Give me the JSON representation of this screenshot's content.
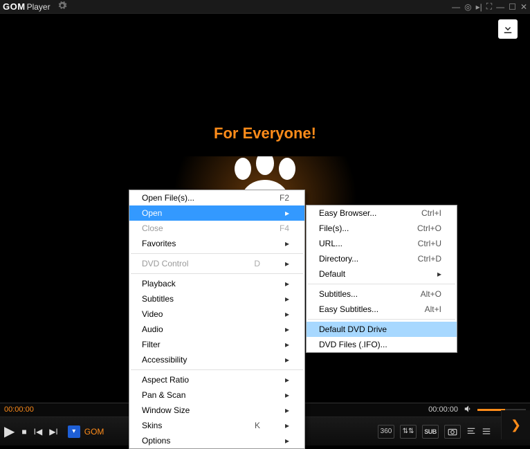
{
  "app": {
    "logo_bold": "GOM",
    "logo_rest": "Player"
  },
  "hero": {
    "title": "For Everyone!"
  },
  "menu_main": [
    {
      "type": "item",
      "label": "Open File(s)...",
      "shortcut": "F2"
    },
    {
      "type": "item",
      "label": "Open",
      "arrow": true,
      "state": "highlight"
    },
    {
      "type": "item",
      "label": "Close",
      "shortcut": "F4",
      "state": "disabled"
    },
    {
      "type": "item",
      "label": "Favorites",
      "arrow": true
    },
    {
      "type": "sep"
    },
    {
      "type": "item",
      "label": "DVD Control",
      "shortcut": "D",
      "arrow": true,
      "state": "disabled"
    },
    {
      "type": "sep"
    },
    {
      "type": "item",
      "label": "Playback",
      "arrow": true
    },
    {
      "type": "item",
      "label": "Subtitles",
      "arrow": true
    },
    {
      "type": "item",
      "label": "Video",
      "arrow": true
    },
    {
      "type": "item",
      "label": "Audio",
      "arrow": true
    },
    {
      "type": "item",
      "label": "Filter",
      "arrow": true
    },
    {
      "type": "item",
      "label": "Accessibility",
      "arrow": true
    },
    {
      "type": "sep"
    },
    {
      "type": "item",
      "label": "Aspect Ratio",
      "arrow": true
    },
    {
      "type": "item",
      "label": "Pan & Scan",
      "arrow": true
    },
    {
      "type": "item",
      "label": "Window Size",
      "arrow": true
    },
    {
      "type": "item",
      "label": "Skins",
      "shortcut": "K",
      "arrow": true
    },
    {
      "type": "item",
      "label": "Options",
      "arrow": true
    }
  ],
  "menu_sub": [
    {
      "type": "item",
      "label": "Easy Browser...",
      "shortcut": "Ctrl+I"
    },
    {
      "type": "item",
      "label": "File(s)...",
      "shortcut": "Ctrl+O"
    },
    {
      "type": "item",
      "label": "URL...",
      "shortcut": "Ctrl+U"
    },
    {
      "type": "item",
      "label": "Directory...",
      "shortcut": "Ctrl+D"
    },
    {
      "type": "item",
      "label": "Default",
      "arrow": true
    },
    {
      "type": "sep"
    },
    {
      "type": "item",
      "label": "Subtitles...",
      "shortcut": "Alt+O"
    },
    {
      "type": "item",
      "label": "Easy Subtitles...",
      "shortcut": "Alt+I"
    },
    {
      "type": "sep"
    },
    {
      "type": "item",
      "label": "Default DVD Drive",
      "state": "sub-highlight"
    },
    {
      "type": "item",
      "label": "DVD Files (.IFO)..."
    }
  ],
  "playback": {
    "elapsed": "00:00:00",
    "total": "00:00:00"
  },
  "nowplaying": {
    "text": "GOM"
  },
  "tools": {
    "mode360": "360",
    "sync": "⇅⇅",
    "sub": "SUB",
    "camera": "◉",
    "eq": "≡",
    "list": "≡"
  }
}
